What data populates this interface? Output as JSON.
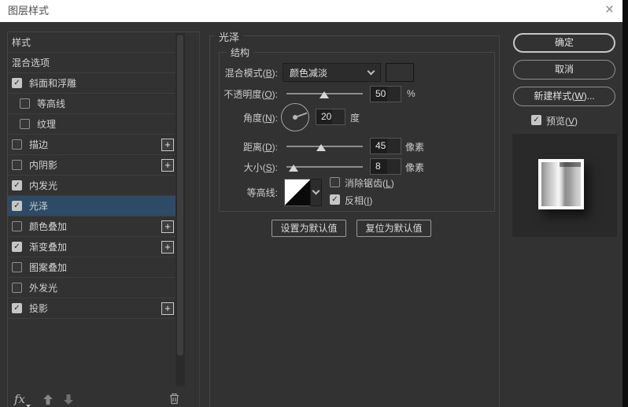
{
  "window": {
    "title": "图层样式",
    "close_glyph": "×"
  },
  "colors": {
    "titlebar_bg": "#ffffff",
    "dialog_bg": "#323232",
    "selection_bg": "#2d4a66",
    "preview_panel_bg": "#292929",
    "swatch_color": "#ffffff",
    "input_bg": "#1d1d1d"
  },
  "icons": {
    "close": "×",
    "check": "✓",
    "plus": "+",
    "fx": "fx"
  },
  "sidebar": {
    "items": [
      {
        "label": "样式",
        "checked": null,
        "indent": false,
        "selected": false,
        "plus": false
      },
      {
        "label": "混合选项",
        "checked": null,
        "indent": false,
        "selected": false,
        "plus": false
      },
      {
        "label": "斜面和浮雕",
        "checked": true,
        "indent": false,
        "selected": false,
        "plus": false
      },
      {
        "label": "等高线",
        "checked": false,
        "indent": true,
        "selected": false,
        "plus": false
      },
      {
        "label": "纹理",
        "checked": false,
        "indent": true,
        "selected": false,
        "plus": false
      },
      {
        "label": "描边",
        "checked": false,
        "indent": false,
        "selected": false,
        "plus": true
      },
      {
        "label": "内阴影",
        "checked": false,
        "indent": false,
        "selected": false,
        "plus": true
      },
      {
        "label": "内发光",
        "checked": true,
        "indent": false,
        "selected": false,
        "plus": false
      },
      {
        "label": "光泽",
        "checked": true,
        "indent": false,
        "selected": true,
        "plus": false
      },
      {
        "label": "颜色叠加",
        "checked": false,
        "indent": false,
        "selected": false,
        "plus": true
      },
      {
        "label": "渐变叠加",
        "checked": true,
        "indent": false,
        "selected": false,
        "plus": true
      },
      {
        "label": "图案叠加",
        "checked": false,
        "indent": false,
        "selected": false,
        "plus": false
      },
      {
        "label": "外发光",
        "checked": false,
        "indent": false,
        "selected": false,
        "plus": false
      },
      {
        "label": "投影",
        "checked": true,
        "indent": false,
        "selected": false,
        "plus": true
      }
    ]
  },
  "panel": {
    "title": "光泽",
    "group_title": "结构",
    "rows": {
      "blend_mode": {
        "label": {
          "text": "混合模式",
          "key": "B",
          "suffix": ":"
        },
        "value": "颜色减淡"
      },
      "opacity": {
        "label": {
          "text": "不透明度",
          "key": "O",
          "suffix": ":"
        },
        "value": "50",
        "unit": "%",
        "slider_pct": 49
      },
      "angle": {
        "label": {
          "text": "角度",
          "key": "N",
          "suffix": ":"
        },
        "value": "20",
        "unit": "度",
        "angle_deg": 20
      },
      "distance": {
        "label": {
          "text": "距离",
          "key": "D",
          "suffix": ":"
        },
        "value": "45",
        "unit": "像素",
        "slider_pct": 45
      },
      "size": {
        "label": {
          "text": "大小",
          "key": "S",
          "suffix": ":"
        },
        "value": "8",
        "unit": "像素",
        "slider_pct": 9
      },
      "contour": {
        "label": "等高线:",
        "anti_alias": {
          "label": {
            "text": "消除锯齿",
            "key": "L",
            "suffix": ""
          },
          "checked": false
        },
        "invert": {
          "label": {
            "text": "反相",
            "key": "I",
            "suffix": ""
          },
          "checked": true
        }
      }
    },
    "default_buttons": {
      "set": "设置为默认值",
      "reset": "复位为默认值"
    }
  },
  "actions": {
    "ok": "确定",
    "cancel": "取消",
    "new_style": {
      "text": "新建样式",
      "key": "W",
      "suffix": "..."
    },
    "preview": {
      "label": {
        "text": "预览",
        "key": "V",
        "suffix": ""
      },
      "checked": true
    }
  }
}
